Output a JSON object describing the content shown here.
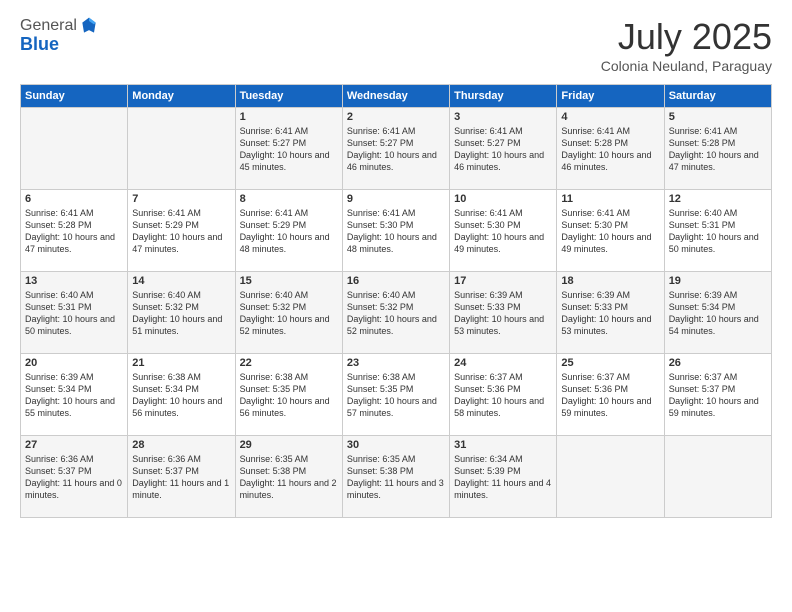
{
  "header": {
    "logo_general": "General",
    "logo_blue": "Blue",
    "month_title": "July 2025",
    "subtitle": "Colonia Neuland, Paraguay"
  },
  "days_of_week": [
    "Sunday",
    "Monday",
    "Tuesday",
    "Wednesday",
    "Thursday",
    "Friday",
    "Saturday"
  ],
  "weeks": [
    [
      {
        "day": "",
        "text": ""
      },
      {
        "day": "",
        "text": ""
      },
      {
        "day": "1",
        "text": "Sunrise: 6:41 AM\nSunset: 5:27 PM\nDaylight: 10 hours and 45 minutes."
      },
      {
        "day": "2",
        "text": "Sunrise: 6:41 AM\nSunset: 5:27 PM\nDaylight: 10 hours and 46 minutes."
      },
      {
        "day": "3",
        "text": "Sunrise: 6:41 AM\nSunset: 5:27 PM\nDaylight: 10 hours and 46 minutes."
      },
      {
        "day": "4",
        "text": "Sunrise: 6:41 AM\nSunset: 5:28 PM\nDaylight: 10 hours and 46 minutes."
      },
      {
        "day": "5",
        "text": "Sunrise: 6:41 AM\nSunset: 5:28 PM\nDaylight: 10 hours and 47 minutes."
      }
    ],
    [
      {
        "day": "6",
        "text": "Sunrise: 6:41 AM\nSunset: 5:28 PM\nDaylight: 10 hours and 47 minutes."
      },
      {
        "day": "7",
        "text": "Sunrise: 6:41 AM\nSunset: 5:29 PM\nDaylight: 10 hours and 47 minutes."
      },
      {
        "day": "8",
        "text": "Sunrise: 6:41 AM\nSunset: 5:29 PM\nDaylight: 10 hours and 48 minutes."
      },
      {
        "day": "9",
        "text": "Sunrise: 6:41 AM\nSunset: 5:30 PM\nDaylight: 10 hours and 48 minutes."
      },
      {
        "day": "10",
        "text": "Sunrise: 6:41 AM\nSunset: 5:30 PM\nDaylight: 10 hours and 49 minutes."
      },
      {
        "day": "11",
        "text": "Sunrise: 6:41 AM\nSunset: 5:30 PM\nDaylight: 10 hours and 49 minutes."
      },
      {
        "day": "12",
        "text": "Sunrise: 6:40 AM\nSunset: 5:31 PM\nDaylight: 10 hours and 50 minutes."
      }
    ],
    [
      {
        "day": "13",
        "text": "Sunrise: 6:40 AM\nSunset: 5:31 PM\nDaylight: 10 hours and 50 minutes."
      },
      {
        "day": "14",
        "text": "Sunrise: 6:40 AM\nSunset: 5:32 PM\nDaylight: 10 hours and 51 minutes."
      },
      {
        "day": "15",
        "text": "Sunrise: 6:40 AM\nSunset: 5:32 PM\nDaylight: 10 hours and 52 minutes."
      },
      {
        "day": "16",
        "text": "Sunrise: 6:40 AM\nSunset: 5:32 PM\nDaylight: 10 hours and 52 minutes."
      },
      {
        "day": "17",
        "text": "Sunrise: 6:39 AM\nSunset: 5:33 PM\nDaylight: 10 hours and 53 minutes."
      },
      {
        "day": "18",
        "text": "Sunrise: 6:39 AM\nSunset: 5:33 PM\nDaylight: 10 hours and 53 minutes."
      },
      {
        "day": "19",
        "text": "Sunrise: 6:39 AM\nSunset: 5:34 PM\nDaylight: 10 hours and 54 minutes."
      }
    ],
    [
      {
        "day": "20",
        "text": "Sunrise: 6:39 AM\nSunset: 5:34 PM\nDaylight: 10 hours and 55 minutes."
      },
      {
        "day": "21",
        "text": "Sunrise: 6:38 AM\nSunset: 5:34 PM\nDaylight: 10 hours and 56 minutes."
      },
      {
        "day": "22",
        "text": "Sunrise: 6:38 AM\nSunset: 5:35 PM\nDaylight: 10 hours and 56 minutes."
      },
      {
        "day": "23",
        "text": "Sunrise: 6:38 AM\nSunset: 5:35 PM\nDaylight: 10 hours and 57 minutes."
      },
      {
        "day": "24",
        "text": "Sunrise: 6:37 AM\nSunset: 5:36 PM\nDaylight: 10 hours and 58 minutes."
      },
      {
        "day": "25",
        "text": "Sunrise: 6:37 AM\nSunset: 5:36 PM\nDaylight: 10 hours and 59 minutes."
      },
      {
        "day": "26",
        "text": "Sunrise: 6:37 AM\nSunset: 5:37 PM\nDaylight: 10 hours and 59 minutes."
      }
    ],
    [
      {
        "day": "27",
        "text": "Sunrise: 6:36 AM\nSunset: 5:37 PM\nDaylight: 11 hours and 0 minutes."
      },
      {
        "day": "28",
        "text": "Sunrise: 6:36 AM\nSunset: 5:37 PM\nDaylight: 11 hours and 1 minute."
      },
      {
        "day": "29",
        "text": "Sunrise: 6:35 AM\nSunset: 5:38 PM\nDaylight: 11 hours and 2 minutes."
      },
      {
        "day": "30",
        "text": "Sunrise: 6:35 AM\nSunset: 5:38 PM\nDaylight: 11 hours and 3 minutes."
      },
      {
        "day": "31",
        "text": "Sunrise: 6:34 AM\nSunset: 5:39 PM\nDaylight: 11 hours and 4 minutes."
      },
      {
        "day": "",
        "text": ""
      },
      {
        "day": "",
        "text": ""
      }
    ]
  ]
}
